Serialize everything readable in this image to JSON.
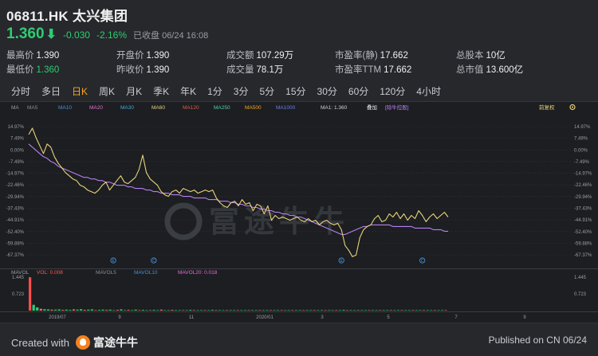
{
  "stock": {
    "code": "06811.HK",
    "name": "太兴集团",
    "price": "1.360",
    "arrow": "⬇",
    "change": "-0.030",
    "change_pct": "-2.16%",
    "status": "已收盘 06/24 16:08"
  },
  "stats": [
    {
      "label": "最高价",
      "value": "1.390",
      "color": "white"
    },
    {
      "label": "开盘价",
      "value": "1.390",
      "color": "white"
    },
    {
      "label": "成交额",
      "value": "107.29万",
      "color": "white"
    },
    {
      "label": "市盈率(静)",
      "value": "17.662",
      "color": "white"
    },
    {
      "label": "总股本",
      "value": "10亿",
      "color": "white"
    },
    {
      "label": "最低价",
      "value": "1.360",
      "color": "green"
    },
    {
      "label": "昨收价",
      "value": "1.390",
      "color": "white"
    },
    {
      "label": "成交量",
      "value": "78.1万",
      "color": "white"
    },
    {
      "label": "市盈率TTM",
      "value": "17.662",
      "color": "white"
    },
    {
      "label": "总市值",
      "value": "13.600亿",
      "color": "white"
    }
  ],
  "tabs": [
    "分时",
    "多日",
    "日K",
    "周K",
    "月K",
    "季K",
    "年K",
    "1分",
    "3分",
    "5分",
    "15分",
    "30分",
    "60分",
    "120分",
    "4小时"
  ],
  "active_tab": "日K",
  "chart": {
    "ma_label": "MA",
    "ma_legend": [
      "MA5",
      "MA10",
      "MA20",
      "MA30",
      "MA60",
      "MA120",
      "MA250",
      "MA500",
      "MA1000"
    ],
    "ma1_label": "MA1: 1.360",
    "overlay_label": "叠加",
    "rehab_label": "[除牛控股]",
    "adjust_label": "前复权",
    "watermark": "富途牛牛",
    "y_ticks_left": [
      "14.97%",
      "7.49%",
      "0.00%",
      "-7.49%",
      "-14.97%",
      "-22.46%",
      "-29.94%",
      "-37.43%",
      "-44.91%",
      "-52.40%",
      "-59.88%",
      "-67.37%"
    ],
    "y_ticks_right": [
      "14.97%",
      "7.49%",
      "0.00%",
      "-7.49%",
      "-14.97%",
      "-22.46%",
      "-29.94%",
      "-37.43%",
      "-44.91%",
      "-52.40%",
      "-59.88%",
      "-67.37%"
    ],
    "vol_label": "MAVOL",
    "vol_value": "VOL: 0.008",
    "mavol5": "MAVOL5",
    "mavol10": "MAVOL10",
    "mavol20": "MAVOL20: 0.018",
    "vol_ticks_left": [
      "1.445",
      "0.723"
    ],
    "vol_ticks_right": [
      "1.445",
      "0.723"
    ],
    "x_ticks": [
      "2019/07",
      "9",
      "11",
      "2020/01",
      "3",
      "5",
      "7",
      "9"
    ]
  },
  "chart_data": {
    "type": "line",
    "y_unit": "%",
    "ylim": [
      -67.37,
      14.97
    ],
    "series": [
      {
        "color": "#e8d27a",
        "values": [
          10,
          14,
          8,
          3,
          -2,
          4,
          2,
          -4,
          -8,
          -11,
          -14,
          -16,
          -18,
          -19,
          -22,
          -23,
          -25,
          -26,
          -27,
          -25,
          -22,
          -20,
          -25,
          -22,
          -19,
          -16,
          -20,
          -21,
          -19,
          -17,
          -12,
          -3,
          -14,
          -18,
          -20,
          -22,
          -26,
          -28,
          -29,
          -26,
          -25,
          -27,
          -24,
          -25,
          -26,
          -25,
          -27,
          -26,
          -25,
          -26,
          -25,
          -30,
          -33,
          -35,
          -36,
          -33,
          -32,
          -35,
          -31,
          -34,
          -33,
          -38,
          -34,
          -35,
          -40,
          -35,
          -44,
          -41,
          -43,
          -42,
          -43,
          -44,
          -43,
          -42,
          -44,
          -45,
          -43,
          -45,
          -44,
          -47,
          -45,
          -44,
          -46,
          -47,
          -46,
          -50,
          -60,
          -63,
          -67,
          -66,
          -55,
          -50,
          -48,
          -47,
          -43,
          -41,
          -45,
          -44,
          -40,
          -42,
          -39,
          -43,
          -40,
          -44,
          -41,
          -43,
          -38,
          -41,
          -45,
          -42,
          -40,
          -43,
          -41,
          -39,
          -42
        ]
      },
      {
        "color": "#b77ff0",
        "values": [
          4,
          2,
          0,
          -2,
          -4,
          -5,
          -7,
          -8,
          -10,
          -11,
          -12,
          -13,
          -14,
          -15,
          -16,
          -17,
          -17,
          -18,
          -18,
          -19,
          -19,
          -20,
          -20,
          -21,
          -22,
          -22,
          -22,
          -23,
          -23,
          -24,
          -24,
          -24,
          -25,
          -25,
          -26,
          -26,
          -27,
          -27,
          -27,
          -28,
          -28,
          -28,
          -29,
          -29,
          -29,
          -30,
          -30,
          -30,
          -30,
          -31,
          -31,
          -31,
          -32,
          -32,
          -32,
          -33,
          -33,
          -34,
          -34,
          -35,
          -35,
          -36,
          -36,
          -37,
          -37,
          -38,
          -38,
          -39,
          -39,
          -40,
          -40,
          -41,
          -41,
          -42,
          -42,
          -43,
          -44,
          -45,
          -46,
          -47,
          -48,
          -49,
          -50,
          -51,
          -52,
          -53,
          -53,
          -52,
          -51,
          -50,
          -49,
          -48,
          -48,
          -47,
          -47,
          -47,
          -47,
          -47,
          -47,
          -48,
          -48,
          -48,
          -48,
          -48,
          -48,
          -49,
          -49,
          -49,
          -49,
          -49,
          -50,
          -50,
          -50,
          -51,
          -51
        ]
      }
    ],
    "volume": [
      1.44,
      0.25,
      0.14,
      0.08,
      0.06,
      0.05,
      0.04,
      0.04,
      0.05,
      0.03,
      0.04,
      0.03,
      0.05,
      0.04,
      0.06,
      0.03,
      0.04,
      0.05,
      0.02,
      0.03,
      0.04,
      0.03,
      0.04,
      0.02,
      0.03,
      0.05,
      0.02,
      0.03,
      0.02,
      0.04,
      0.02,
      0.03,
      0.02,
      0.02,
      0.03,
      0.02,
      0.04,
      0.02,
      0.02,
      0.03,
      0.02,
      0.02,
      0.01,
      0.02,
      0.03,
      0.02,
      0.01,
      0.02,
      0.02,
      0.01,
      0.03,
      0.02,
      0.01,
      0.02,
      0.01,
      0.02,
      0.01,
      0.02,
      0.01,
      0.01,
      0.02,
      0.01,
      0.02,
      0.01,
      0.02,
      0.01,
      0.01,
      0.02,
      0.01,
      0.01,
      0.02,
      0.01,
      0.02,
      0.01,
      0.01,
      0.02,
      0.01,
      0.01,
      0.02,
      0.01,
      0.01,
      0.02,
      0.01,
      0.01,
      0.02,
      0.01,
      0.03,
      0.01,
      0.02,
      0.01,
      0.01,
      0.02,
      0.01,
      0.01,
      0.02,
      0.01,
      0.01,
      0.02,
      0.01,
      0.01,
      0.02,
      0.01,
      0.01,
      0.01,
      0.02,
      0.01,
      0.01,
      0.02,
      0.01,
      0.01,
      0.02,
      0.01,
      0.01,
      0.01,
      0.01
    ],
    "volume_max": 1.445,
    "markers": [
      {
        "index": 23,
        "glyph": "E"
      },
      {
        "index": 34,
        "glyph": "C"
      },
      {
        "index": 85,
        "glyph": "E"
      },
      {
        "index": 107,
        "glyph": "C"
      }
    ]
  },
  "footer": {
    "created_with": "Created with",
    "brand": "富途牛牛",
    "published": "Published on CN 06/24"
  }
}
